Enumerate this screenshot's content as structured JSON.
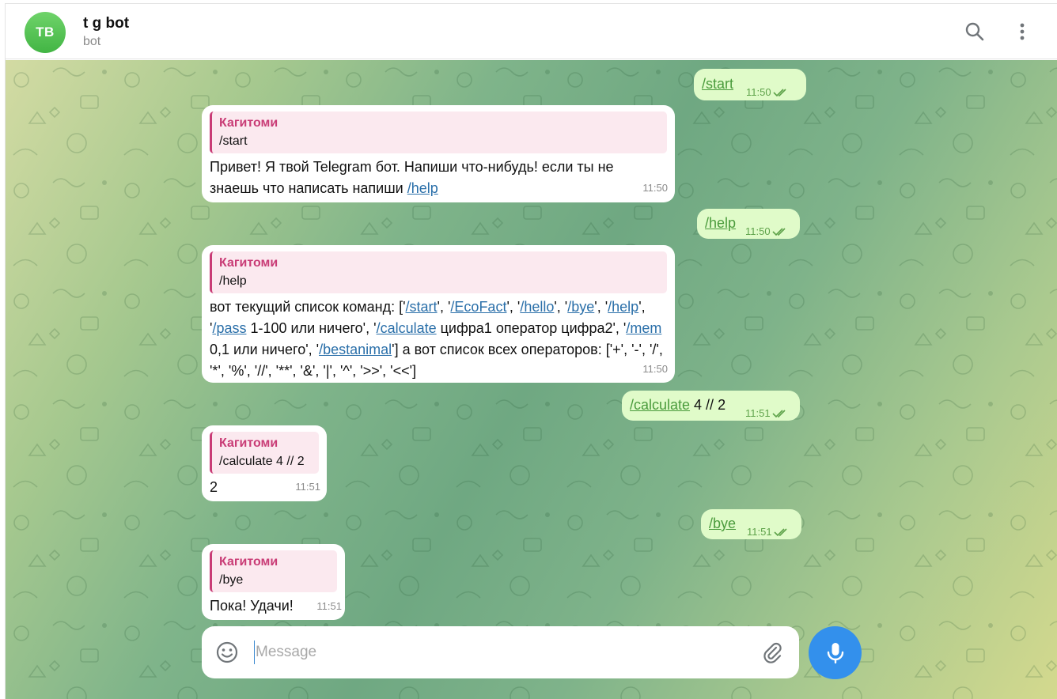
{
  "header": {
    "avatar_initials": "TB",
    "title": "t g bot",
    "status": "bot",
    "search_icon": "search-icon",
    "more_icon": "more-vertical-icon"
  },
  "colors": {
    "avatar": "#4fbf4c",
    "incoming_bubble": "#ffffff",
    "outgoing_bubble": "#e0fbc9",
    "reply_accent": "#c93c76",
    "link": "#2a6fa9",
    "mic_button": "#3390ec"
  },
  "messages": [
    {
      "dir": "out",
      "text": "/start",
      "time": "11:50",
      "status": "read"
    },
    {
      "dir": "in",
      "reply_author": "Кагитоми",
      "reply_text": "/start",
      "text_a": "Привет! Я твой Telegram бот. Напиши что-нибудь! если ты не знаешь что написать напиши ",
      "link": "/help",
      "time": "11:50"
    },
    {
      "dir": "out",
      "text": "/help",
      "time": "11:50",
      "status": "read"
    },
    {
      "dir": "in",
      "reply_author": "Кагитоми",
      "reply_text": "/help",
      "parts": [
        "вот текущий список команд: ['",
        "/start",
        "', '",
        "/EcoFact",
        "', '",
        "/hello",
        "', '",
        "/bye",
        "', '",
        "/help",
        "', '",
        "/pass",
        " 1-100 или ничего', '",
        "/calculate",
        " цифра1 оператор цифра2', '",
        "/mem",
        " 0,1 или ничего', '",
        "/bestanimal",
        "'] а вот список всех операторов: ['+', '-', '/', '*', '%', '//', '**', '&', '|', '^', '>>', '<<']"
      ],
      "time": "11:50"
    },
    {
      "dir": "out",
      "link": "/calculate",
      "text": " 4 // 2",
      "time": "11:51",
      "status": "read"
    },
    {
      "dir": "in",
      "reply_author": "Кагитоми",
      "reply_text": "/calculate 4 // 2",
      "text": "2",
      "time": "11:51"
    },
    {
      "dir": "out",
      "text": "/bye",
      "time": "11:51",
      "status": "read"
    },
    {
      "dir": "in",
      "reply_author": "Кагитоми",
      "reply_text": "/bye",
      "text": "Пока! Удачи!",
      "time": "11:51"
    }
  ],
  "composer": {
    "placeholder": "Message",
    "value": "",
    "emoji_icon": "smile-icon",
    "attach_icon": "paperclip-icon",
    "mic_icon": "microphone-icon"
  }
}
